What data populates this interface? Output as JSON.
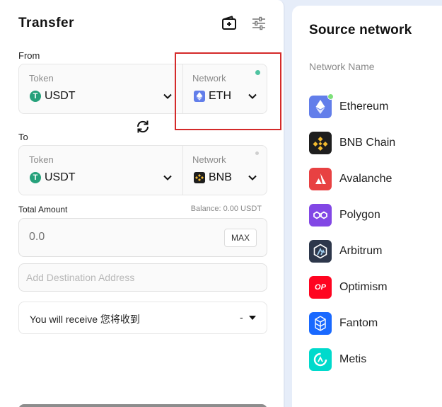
{
  "transfer": {
    "title": "Transfer",
    "from": {
      "label": "From",
      "token_label": "Token",
      "token_value": "USDT",
      "network_label": "Network",
      "network_value": "ETH"
    },
    "to": {
      "label": "To",
      "token_label": "Token",
      "token_value": "USDT",
      "network_label": "Network",
      "network_value": "BNB"
    },
    "amount": {
      "label": "Total Amount",
      "balance": "Balance: 0.00 USDT",
      "placeholder": "0.0",
      "max_label": "MAX"
    },
    "destination": {
      "placeholder": "Add Destination Address"
    },
    "receive": {
      "label": "You will receive 您将收到",
      "value": "-"
    }
  },
  "source_network": {
    "title": "Source network",
    "subtitle": "Network Name",
    "items": [
      {
        "name": "Ethereum",
        "icon": "ethereum-icon",
        "color": "#627eea"
      },
      {
        "name": "BNB Chain",
        "icon": "bnb-icon",
        "color": "#1e1e1e"
      },
      {
        "name": "Avalanche",
        "icon": "avalanche-icon",
        "color": "#e84142"
      },
      {
        "name": "Polygon",
        "icon": "polygon-icon",
        "color": "#8247e5"
      },
      {
        "name": "Arbitrum",
        "icon": "arbitrum-icon",
        "color": "#2d374b"
      },
      {
        "name": "Optimism",
        "icon": "optimism-icon",
        "color": "#ff0420"
      },
      {
        "name": "Fantom",
        "icon": "fantom-icon",
        "color": "#1969ff"
      },
      {
        "name": "Metis",
        "icon": "metis-icon",
        "color": "#00dacc"
      }
    ]
  },
  "colors": {
    "usdt": "#26a17b",
    "status_dot": "#4fc3a1",
    "highlight": "#d42a2a"
  }
}
